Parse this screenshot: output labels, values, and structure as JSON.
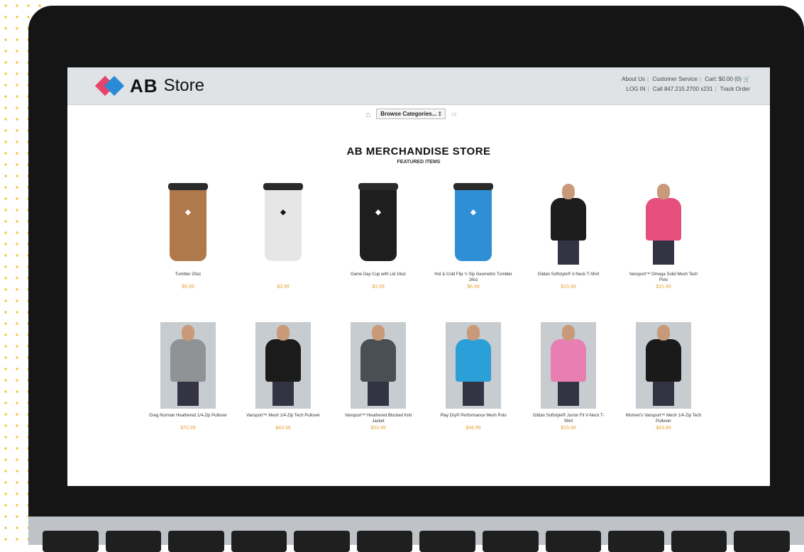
{
  "header": {
    "logo_ab": "AB",
    "logo_store": "Store",
    "links_line1": [
      "About Us",
      "Customer Service",
      "Cart: $0.00 (0)"
    ],
    "links_line2": [
      "LOG IN",
      "Call 847.215.2700 x231",
      "Track Order"
    ]
  },
  "toolbar": {
    "browse_label": "Browse Categories... ‡"
  },
  "main": {
    "title": "AB MERCHANDISE STORE",
    "subtitle": "FEATURED ITEMS"
  },
  "products_row1": [
    {
      "name": "Tumbler 20oz",
      "price": "$9.99",
      "kind": "cup",
      "color": "#b0794c"
    },
    {
      "name": "",
      "price": "$3.99",
      "kind": "cup",
      "color": "#e6e6e6"
    },
    {
      "name": "Game Day Cup with Lid 16oz",
      "price": "$3.99",
      "kind": "cup",
      "color": "#1e1e1e"
    },
    {
      "name": "Hot & Cold Flip 'n Sip Geometric Tumbler 16oz",
      "price": "$6.99",
      "kind": "cup",
      "color": "#2f8fd6"
    },
    {
      "name": "Gildan Softstyle® V-Neck T-Shirt",
      "price": "$15.99",
      "kind": "shirt",
      "color": "#1d1d1d"
    },
    {
      "name": "Vansport™ Omega Solid Mesh Tech Polo",
      "price": "$31.99",
      "kind": "shirt",
      "color": "#e54f7d"
    }
  ],
  "products_row2": [
    {
      "name": "Greg Norman Heathered 1/4-Zip Pullover",
      "price": "$70.99",
      "kind": "shirt",
      "color": "#8f9396"
    },
    {
      "name": "Vansport™ Mesh 1/4-Zip Tech Pullover",
      "price": "$43.99",
      "kind": "shirt",
      "color": "#1b1b1b"
    },
    {
      "name": "Vansport™ Heathered Blocked Knit Jacket",
      "price": "$53.99",
      "kind": "shirt",
      "color": "#4a4f53"
    },
    {
      "name": "Play Dry® Performance Mesh Polo",
      "price": "$46.99",
      "kind": "shirt",
      "color": "#2a9fd8"
    },
    {
      "name": "Gildan Softstyle® Junior Fit V-Neck T-Shirt",
      "price": "$15.99",
      "kind": "shirt",
      "color": "#e77fb3"
    },
    {
      "name": "Women's Vansport™ Mesh 1/4-Zip Tech Pullover",
      "price": "$43.99",
      "kind": "shirt",
      "color": "#1a1a1a"
    }
  ],
  "colors": {
    "accent_price": "#e6a33a",
    "logo_red": "#e8436b",
    "logo_blue": "#2a8ad6"
  }
}
